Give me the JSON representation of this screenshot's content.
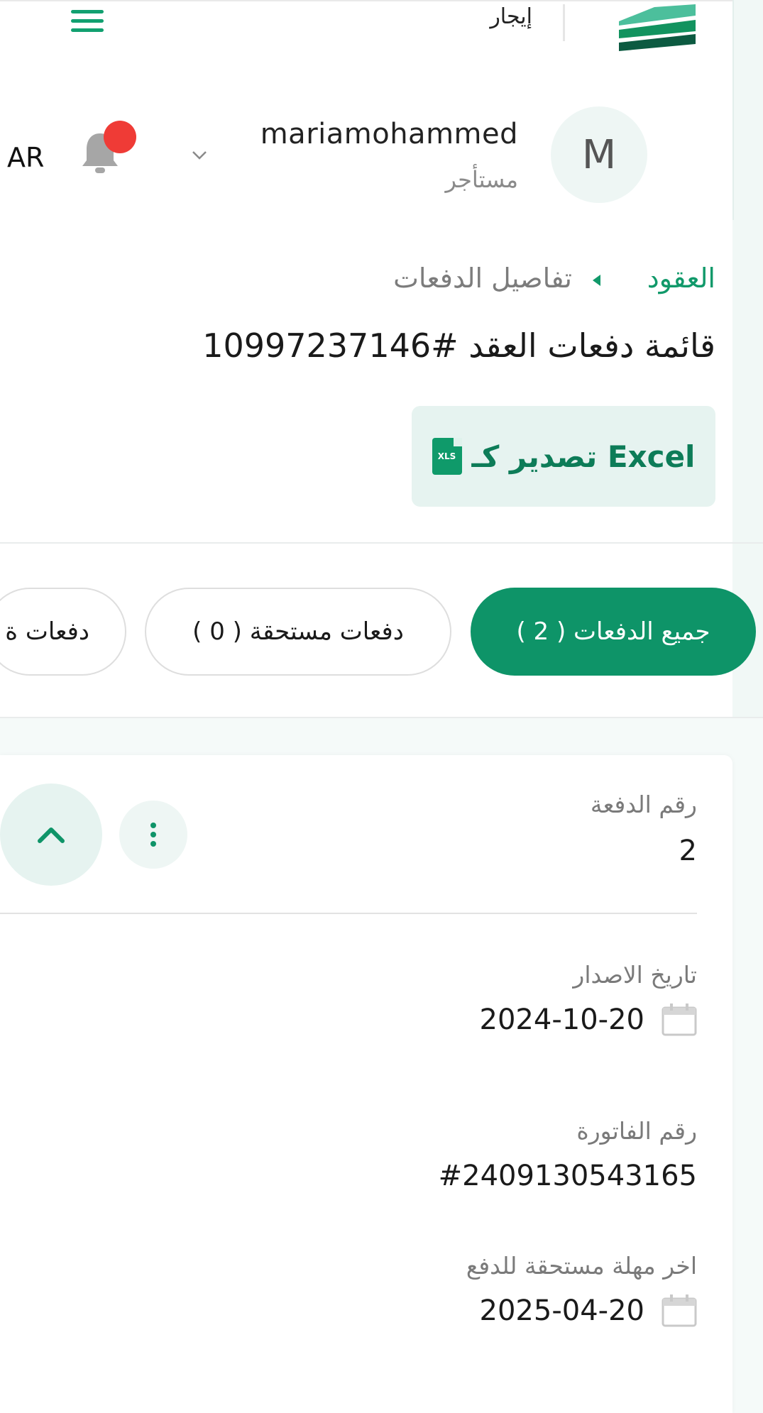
{
  "header": {
    "app_name": "إيجار",
    "menu_icon": "hamburger-icon",
    "logo_icon": "ejar-logo"
  },
  "user": {
    "language": "AR",
    "name": "mariamohammed",
    "role": "مستأجر",
    "avatar_initial": "M"
  },
  "breadcrumb": {
    "root": "العقود",
    "current": "تفاصيل الدفعات"
  },
  "page": {
    "title": "قائمة دفعات العقد #10997237146",
    "export_label": "تصدير كـ Excel",
    "export_icon_text": "XLS"
  },
  "tabs": [
    {
      "label": "جميع الدفعات ( 2 )",
      "active": true
    },
    {
      "label": "دفعات مستحقة ( 0 )",
      "active": false
    },
    {
      "label": "دفعات ة",
      "active": false
    }
  ],
  "payment": {
    "number_label": "رقم الدفعة",
    "number_value": "2",
    "issue_date_label": "تاريخ الاصدار",
    "issue_date_value": "2024-10-20",
    "invoice_label": "رقم الفاتورة",
    "invoice_value": "#2409130543165",
    "due_label": "اخر مهلة مستحقة للدفع",
    "due_value": "2025-04-20"
  },
  "colors": {
    "brand_green": "#0e9468",
    "notification_red": "#ef3b36",
    "light_green_bg": "#e6f3f0"
  }
}
